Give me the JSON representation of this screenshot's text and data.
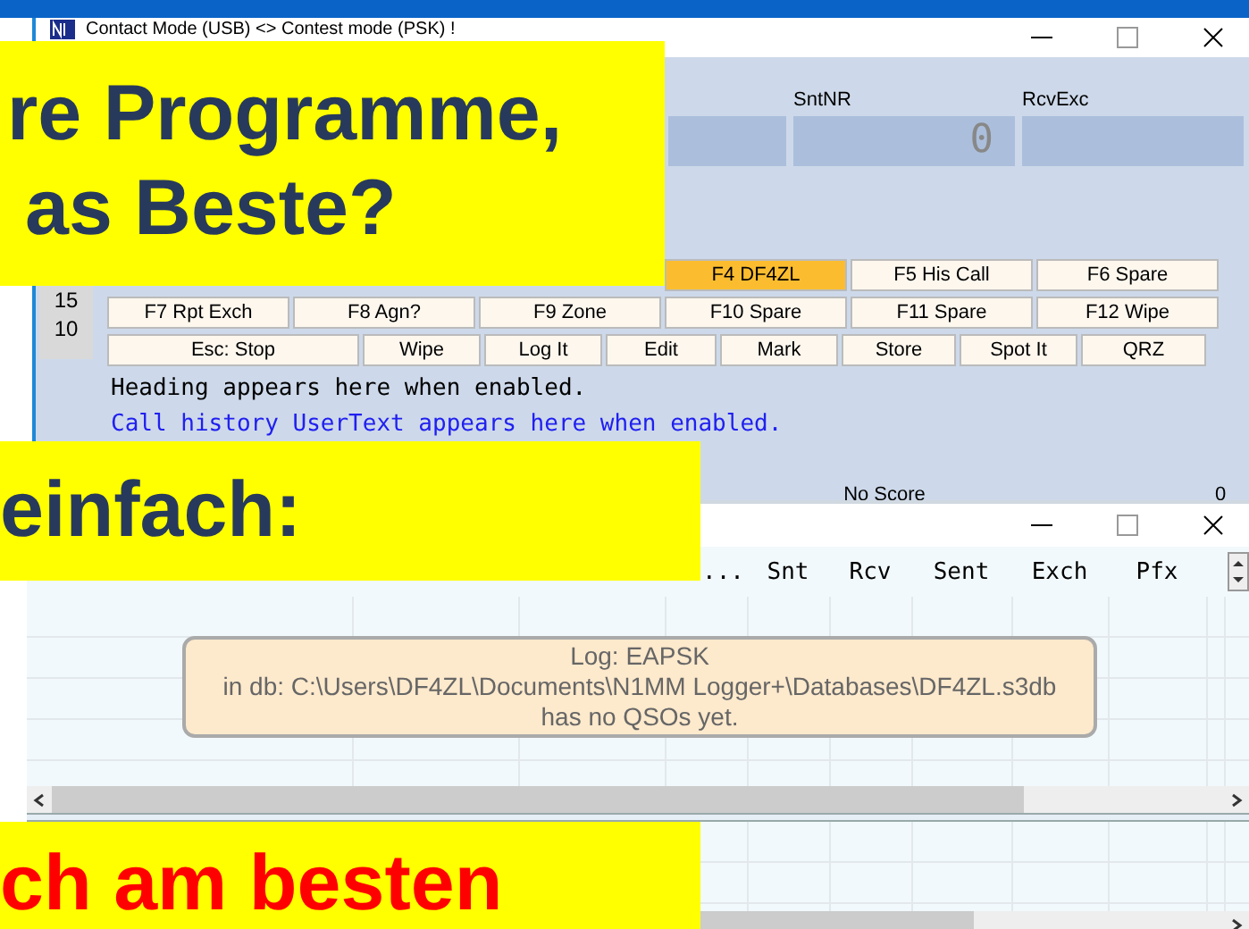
{
  "contest_window": {
    "title": "Contact Mode (USB) <> Contest mode (PSK) !",
    "fields": [
      {
        "label": "SntNR",
        "value": "0"
      },
      {
        "label": "RcvExc"
      }
    ],
    "side_numbers": [
      "15",
      "10"
    ],
    "function_keys": [
      [
        {
          "label": "F4 DF4ZL",
          "highlighted": true
        },
        {
          "label": "F5 His Call",
          "highlighted": false
        },
        {
          "label": "F6 Spare",
          "highlighted": false
        }
      ],
      [
        {
          "label": "F7 Rpt Exch",
          "highlighted": false
        },
        {
          "label": "F8 Agn?",
          "highlighted": false
        },
        {
          "label": "F9 Zone",
          "highlighted": false
        },
        {
          "label": "F10 Spare",
          "highlighted": false
        },
        {
          "label": "F11 Spare",
          "highlighted": false
        },
        {
          "label": "F12 Wipe",
          "highlighted": false
        }
      ]
    ],
    "action_buttons": [
      "Esc: Stop",
      "Wipe",
      "Log It",
      "Edit",
      "Mark",
      "Store",
      "Spot It",
      "QRZ"
    ],
    "heading_text": "Heading appears here when enabled.",
    "user_text": "Call history UserText appears here when enabled.",
    "status": "No Score",
    "score": "0"
  },
  "log_window": {
    "columns": [
      "...",
      "Snt",
      "Rcv",
      "Sent",
      "Exch",
      "Pfx"
    ],
    "message": [
      "Log: EAPSK",
      "in db: C:\\Users\\DF4ZL\\Documents\\N1MM Logger+\\Databases\\DF4ZL.s3db",
      "has no QSOs yet."
    ]
  },
  "banners": [
    {
      "lines": [
        "re Programme,",
        "as Beste?"
      ],
      "color": "#283a5c"
    },
    {
      "lines": [
        "einfach:"
      ],
      "color": "#283a5c"
    },
    {
      "lines": [
        "ch am besten"
      ],
      "color": "#ff0000"
    }
  ]
}
